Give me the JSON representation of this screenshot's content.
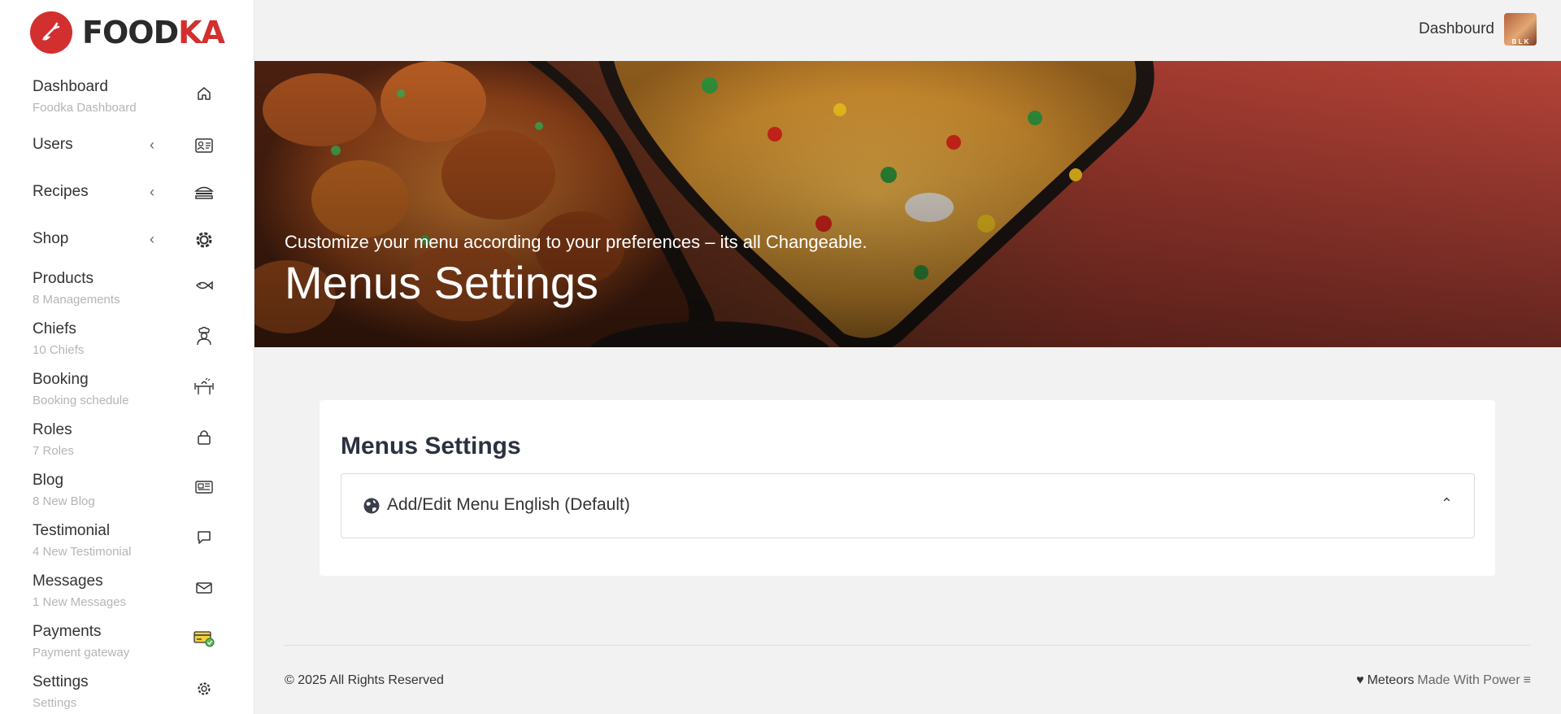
{
  "brand": {
    "part1": "FOOD",
    "part2": "KA",
    "accent": "#d32f2f"
  },
  "sidebar": {
    "items": [
      {
        "label": "Dashboard",
        "sub": "Foodka Dashboard",
        "icon": "home-icon"
      },
      {
        "label": "Users",
        "sub": "",
        "chevron": "‹",
        "icon": "id-card-icon"
      },
      {
        "label": "Recipes",
        "sub": "",
        "chevron": "‹",
        "icon": "burger-icon"
      },
      {
        "label": "Shop",
        "sub": "",
        "chevron": "‹",
        "icon": "gear-shop-icon"
      },
      {
        "label": "Products",
        "sub": "8 Managements",
        "icon": "fish-icon"
      },
      {
        "label": "Chiefs",
        "sub": "10 Chiefs",
        "icon": "chef-icon"
      },
      {
        "label": "Booking",
        "sub": "Booking schedule",
        "icon": "dining-icon"
      },
      {
        "label": "Roles",
        "sub": "7 Roles",
        "icon": "lock-icon"
      },
      {
        "label": "Blog",
        "sub": "8 New Blog",
        "icon": "newspaper-icon"
      },
      {
        "label": "Testimonial",
        "sub": "4 New Testimonial",
        "icon": "chat-icon"
      },
      {
        "label": "Messages",
        "sub": "1 New Messages",
        "icon": "mail-icon"
      },
      {
        "label": "Payments",
        "sub": "Payment gateway",
        "icon": "payment-card-icon"
      },
      {
        "label": "Settings",
        "sub": "Settings",
        "icon": "settings-icon"
      }
    ]
  },
  "topbar": {
    "link": "Dashbourd",
    "avatar_text": "B L K"
  },
  "hero": {
    "subtitle": "Customize your menu according to your preferences – its all Changeable.",
    "title": "Menus Settings"
  },
  "card": {
    "title": "Menus Settings",
    "accordion_label": "Add/Edit Menu English (Default)",
    "accordion_chevron": "⌃"
  },
  "footer": {
    "copyright": "© 2025 All Rights Reserved",
    "heart": "♥",
    "brand": "Meteors",
    "tagline": "Made With Power",
    "menu_glyph": "≡"
  }
}
